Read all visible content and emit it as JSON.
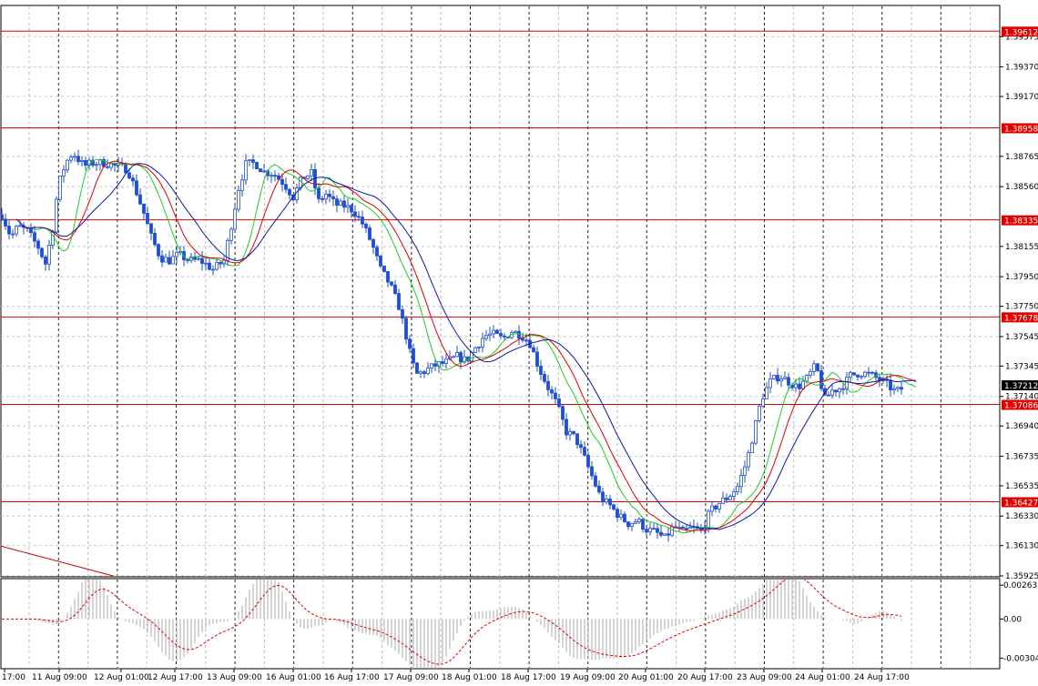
{
  "chart_data": [
    {
      "type": "candlestick",
      "instrument_hint": "",
      "ylim": [
        1.35925,
        1.3978
      ],
      "y_ticks": [
        "1.39575",
        "1.39370",
        "1.39170",
        "1.38765",
        "1.38560",
        "1.38155",
        "1.37950",
        "1.37750",
        "1.37545",
        "1.37345",
        "1.37140",
        "1.36940",
        "1.36735",
        "1.36535",
        "1.36330",
        "1.36130",
        "1.35925"
      ],
      "x_ticks": [
        "17:00",
        "11 Aug 09:00",
        "12 Aug 01:00",
        "12 Aug 17:00",
        "13 Aug 09:00",
        "16 Aug 01:00",
        "16 Aug 17:00",
        "17 Aug 09:00",
        "18 Aug 01:00",
        "18 Aug 17:00",
        "19 Aug 09:00",
        "20 Aug 01:00",
        "20 Aug 17:00",
        "23 Aug 09:00",
        "24 Aug 01:00",
        "24 Aug 17:00"
      ],
      "horizontal_levels": [
        "1.39612",
        "1.38958",
        "1.38335",
        "1.37678",
        "1.37086",
        "1.36427"
      ],
      "current_price": "1.37212",
      "level_color": "#e00000",
      "candle_color": "#1f4fd0",
      "ma_colors": [
        "#22cc22",
        "#dd0000",
        "#0a1aa8"
      ],
      "trend_line_color": "#cc0000",
      "path_points": [
        [
          0,
          1.384
        ],
        [
          12,
          1.3822
        ],
        [
          20,
          1.3829
        ],
        [
          30,
          1.3826
        ],
        [
          42,
          1.3815
        ],
        [
          50,
          1.3804
        ],
        [
          58,
          1.3828
        ],
        [
          64,
          1.3857
        ],
        [
          72,
          1.3872
        ],
        [
          80,
          1.3879
        ],
        [
          92,
          1.387
        ],
        [
          102,
          1.3872
        ],
        [
          115,
          1.3872
        ],
        [
          126,
          1.387
        ],
        [
          140,
          1.3868
        ],
        [
          150,
          1.3852
        ],
        [
          158,
          1.3838
        ],
        [
          166,
          1.3822
        ],
        [
          176,
          1.3808
        ],
        [
          186,
          1.3806
        ],
        [
          196,
          1.381
        ],
        [
          208,
          1.3806
        ],
        [
          220,
          1.3806
        ],
        [
          234,
          1.38
        ],
        [
          246,
          1.3806
        ],
        [
          254,
          1.383
        ],
        [
          262,
          1.3855
        ],
        [
          270,
          1.3871
        ],
        [
          280,
          1.3872
        ],
        [
          290,
          1.3866
        ],
        [
          300,
          1.3865
        ],
        [
          312,
          1.3858
        ],
        [
          322,
          1.3849
        ],
        [
          332,
          1.3862
        ],
        [
          342,
          1.3865
        ],
        [
          350,
          1.3846
        ],
        [
          358,
          1.3851
        ],
        [
          368,
          1.3844
        ],
        [
          378,
          1.3843
        ],
        [
          388,
          1.384
        ],
        [
          398,
          1.3831
        ],
        [
          408,
          1.3818
        ],
        [
          418,
          1.38
        ],
        [
          428,
          1.379
        ],
        [
          438,
          1.3775
        ],
        [
          446,
          1.3755
        ],
        [
          452,
          1.3738
        ],
        [
          458,
          1.3729
        ],
        [
          466,
          1.3731
        ],
        [
          478,
          1.3735
        ],
        [
          490,
          1.3737
        ],
        [
          502,
          1.3741
        ],
        [
          512,
          1.3738
        ],
        [
          522,
          1.3747
        ],
        [
          532,
          1.3755
        ],
        [
          542,
          1.3756
        ],
        [
          552,
          1.3753
        ],
        [
          562,
          1.3758
        ],
        [
          572,
          1.3756
        ],
        [
          582,
          1.375
        ],
        [
          592,
          1.3733
        ],
        [
          602,
          1.372
        ],
        [
          612,
          1.3708
        ],
        [
          622,
          1.369
        ],
        [
          632,
          1.3686
        ],
        [
          642,
          1.3672
        ],
        [
          652,
          1.3657
        ],
        [
          660,
          1.3645
        ],
        [
          670,
          1.364
        ],
        [
          680,
          1.3633
        ],
        [
          690,
          1.3628
        ],
        [
          700,
          1.363
        ],
        [
          710,
          1.3624
        ],
        [
          720,
          1.3622
        ],
        [
          730,
          1.3618
        ],
        [
          740,
          1.3626
        ],
        [
          750,
          1.3622
        ],
        [
          760,
          1.3625
        ],
        [
          770,
          1.3623
        ],
        [
          780,
          1.3636
        ],
        [
          790,
          1.3642
        ],
        [
          800,
          1.3646
        ],
        [
          810,
          1.3653
        ],
        [
          820,
          1.367
        ],
        [
          828,
          1.369
        ],
        [
          836,
          1.3712
        ],
        [
          846,
          1.3724
        ],
        [
          856,
          1.3728
        ],
        [
          866,
          1.3724
        ],
        [
          876,
          1.372
        ],
        [
          886,
          1.3726
        ],
        [
          896,
          1.3735
        ],
        [
          906,
          1.3712
        ],
        [
          914,
          1.3718
        ],
        [
          924,
          1.372
        ],
        [
          934,
          1.3728
        ],
        [
          944,
          1.373
        ],
        [
          954,
          1.3729
        ],
        [
          964,
          1.3726
        ],
        [
          974,
          1.3722
        ],
        [
          984,
          1.3717
        ],
        [
          992,
          1.372
        ]
      ],
      "macd_ticks": [
        "0.002635",
        "0.00",
        "-0.003046"
      ],
      "macd_ylim": [
        -0.0038,
        0.003
      ]
    }
  ]
}
